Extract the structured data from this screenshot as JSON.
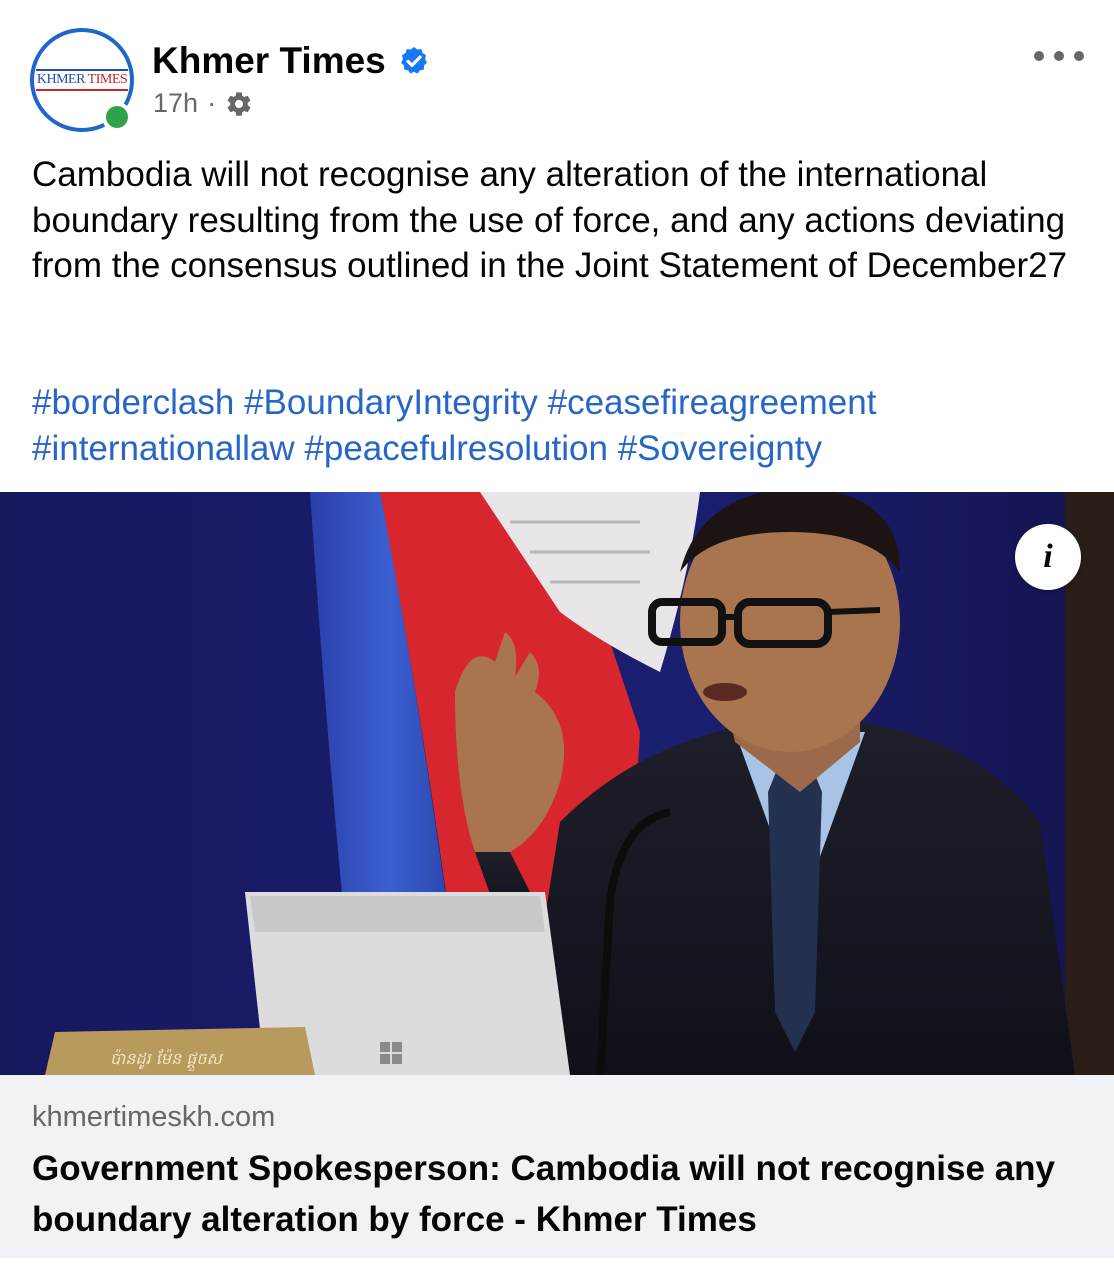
{
  "post": {
    "page_name": "Khmer Times",
    "avatar_logo": "KHMER TIMES",
    "avatar_logo_words": [
      "KHMER",
      "TIMES"
    ],
    "time": "17h",
    "separator": "·",
    "audience_icon": "gear-icon",
    "verified_icon": "verified-badge-icon",
    "more_icon": "more-options-icon",
    "body_text": "Cambodia will not recognise any alteration of the international boundary resulting from the use of force, and any actions deviating from the consensus outlined in the Joint Statement of December27",
    "hashtags": [
      "#borderclash",
      "#BoundaryIntegrity",
      "#ceasefireagreement",
      "#internationallaw",
      "#peacefulresolution",
      "#Sovereignty"
    ],
    "info_button": "i",
    "nameplate_text": "ប៉ានដូរ ម៉ែន ផ្តួចស"
  },
  "link_card": {
    "domain": "khmertimeskh.com",
    "title": "Government Spokesperson: Cambodia will not recognise any boundary alteration by force - Khmer Times"
  },
  "colors": {
    "link_blue": "#2766c7",
    "verified_blue": "#1877f2",
    "online_green": "#31a24c",
    "meta_grey": "#65676b",
    "card_bg": "#f0f2f5"
  }
}
